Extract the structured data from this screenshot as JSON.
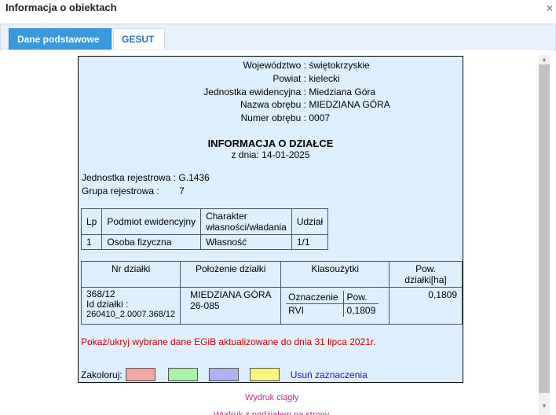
{
  "window": {
    "title": "Informacja o obiektach",
    "close_glyph": "×"
  },
  "tabs": [
    {
      "label": "Dane podstawowe"
    },
    {
      "label": "GESUT"
    }
  ],
  "header_info": [
    {
      "key": "Województwo :",
      "value": "świętokrzyskie"
    },
    {
      "key": "Powiat :",
      "value": "kielecki"
    },
    {
      "key": "Jednostka ewidencyjna :",
      "value": "Miedziana Góra"
    },
    {
      "key": "Nazwa obrębu :",
      "value": "MIEDZIANA GÓRA"
    },
    {
      "key": "Numer obrębu :",
      "value": "0007"
    }
  ],
  "heading": "INFORMACJA O DZIAŁCE",
  "subheading": "z dnia: 14-01-2025",
  "registry": {
    "unit_label": "Jednostka rejestrowa :",
    "unit_value": "G.1436",
    "group_label": "Grupa rejestrowa :",
    "group_value": "7"
  },
  "owners_table": {
    "headers": [
      "Lp",
      "Podmiot ewidencyjny",
      "Charakter własności/władania",
      "Udział"
    ],
    "rows": [
      [
        "1",
        "Osoba fizyczna",
        "Własność",
        "1/1"
      ]
    ]
  },
  "parcel_table": {
    "headers": [
      "Nr działki",
      "Położenie działki",
      "Klasoużytki",
      "Pow. działki[ha]"
    ],
    "nr_dzialki": "368/12",
    "id_label": "Id działki :",
    "id_value": "260410_2.0007.368/12",
    "polozenie_line1": "MIEDZIANA GÓRA",
    "polozenie_line2": "26-085",
    "klas_headers": [
      "Oznaczenie",
      "Pow."
    ],
    "klas_rows": [
      [
        "RVI",
        "0,1809"
      ]
    ],
    "pow": "0,1809"
  },
  "red_note": "Pokaż/ukryj wybrane dane EGiB aktualizowane do dnia 31 lipca 2021r.",
  "colorize": {
    "label": "Zakoloruj:",
    "swatches": [
      "#f4a6a6",
      "#a6f4a6",
      "#b0b0f4",
      "#f6f67a"
    ],
    "clear_label": "Usuń zaznaczenia"
  },
  "print_link": "Wydruk ciągły",
  "print_link2": "Wydruk z podziałem na strony"
}
